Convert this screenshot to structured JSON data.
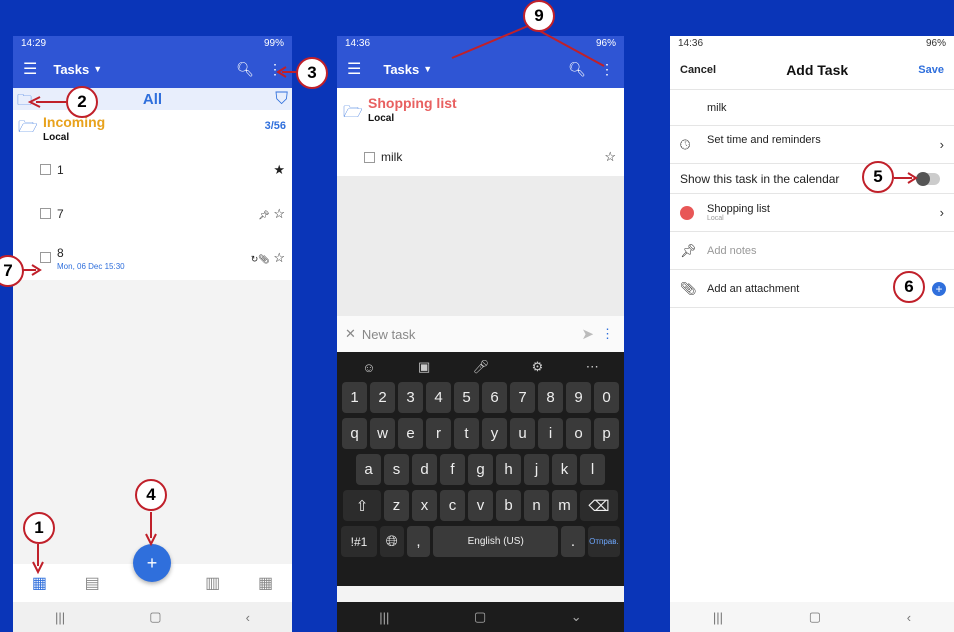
{
  "phone1": {
    "status": {
      "time": "14:29",
      "battery": "99%"
    },
    "appbar": {
      "title": "Tasks"
    },
    "filter": {
      "label": "All"
    },
    "list": {
      "name": "Incoming",
      "sub": "Local",
      "count": "3/56"
    },
    "tasks": [
      {
        "title": "1",
        "date": ""
      },
      {
        "title": "7",
        "date": ""
      },
      {
        "title": "8",
        "date": "Mon, 06 Dec 15:30"
      }
    ]
  },
  "phone2": {
    "status": {
      "time": "14:36",
      "battery": "96%"
    },
    "appbar": {
      "title": "Tasks"
    },
    "list": {
      "name": "Shopping list",
      "sub": "Local"
    },
    "task": {
      "title": "milk"
    },
    "newtask": {
      "placeholder": "New task"
    },
    "keyboard": {
      "row_numbers": [
        "1",
        "2",
        "3",
        "4",
        "5",
        "6",
        "7",
        "8",
        "9",
        "0"
      ],
      "row1": [
        "q",
        "w",
        "e",
        "r",
        "t",
        "y",
        "u",
        "i",
        "o",
        "p"
      ],
      "row2": [
        "a",
        "s",
        "d",
        "f",
        "g",
        "h",
        "j",
        "k",
        "l"
      ],
      "row3": [
        "z",
        "x",
        "c",
        "v",
        "b",
        "n",
        "m"
      ],
      "symbols_key": "!#1",
      "comma": ",",
      "space_label": "English (US)",
      "period": ".",
      "enter_label": "Отправ."
    }
  },
  "phone3": {
    "status": {
      "time": "14:36",
      "battery": "96%"
    },
    "header": {
      "cancel": "Cancel",
      "title": "Add Task",
      "save": "Save"
    },
    "task_title": "milk",
    "rows": {
      "time": "Set time and reminders",
      "calendar": "Show this task in the calendar",
      "list_name": "Shopping list",
      "list_sub": "Local",
      "notes": "Add notes",
      "attachment": "Add an attachment"
    }
  },
  "callouts": [
    "1",
    "2",
    "3",
    "4",
    "5",
    "6",
    "7",
    "9"
  ],
  "colors": {
    "background": "#0a35b8",
    "appbar": "#2f55d4",
    "accent": "#2f6fdc",
    "callout_border": "#c0202a"
  }
}
